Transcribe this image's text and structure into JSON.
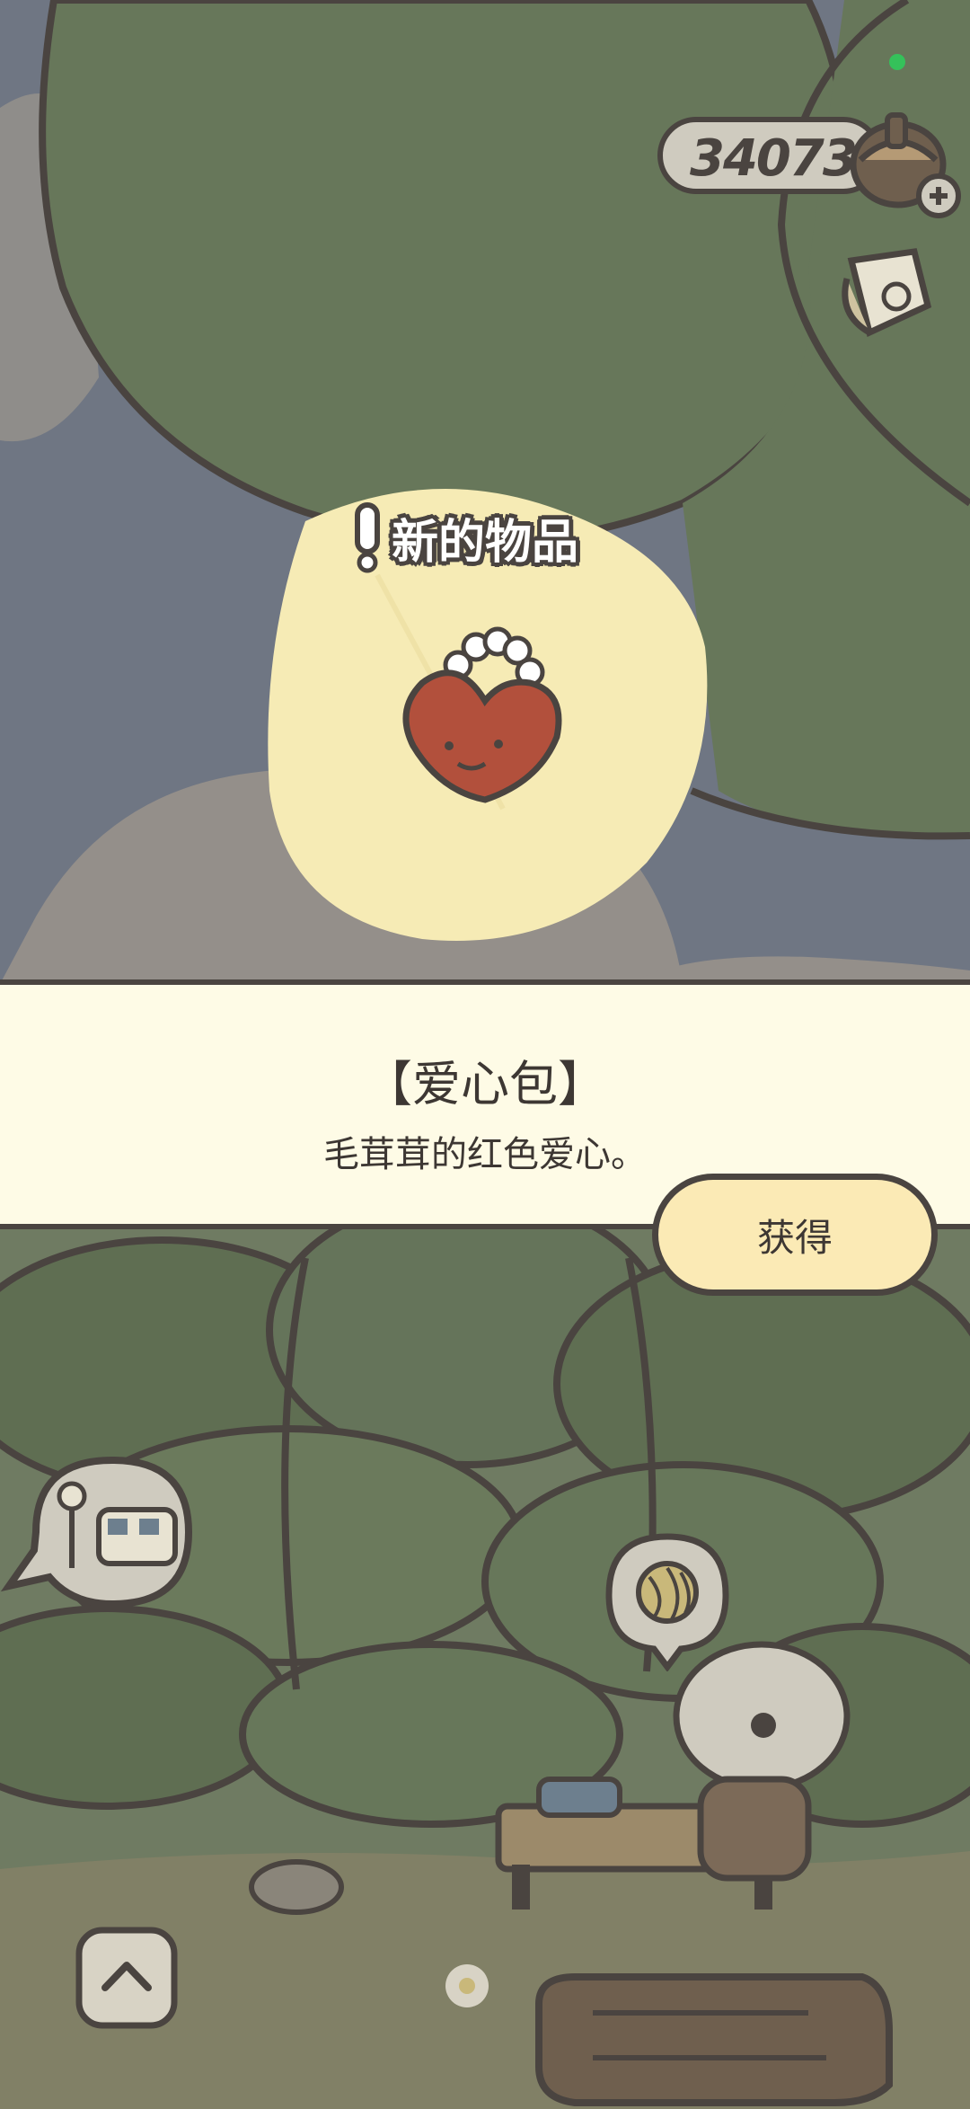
{
  "hud": {
    "acorn_count": "340731",
    "acorn_icon": "acorn-icon",
    "add_icon": "plus-icon",
    "notebook_icon": "notebook-icon"
  },
  "popup": {
    "badge_text": "新的物品",
    "badge_icon": "exclamation-icon",
    "item_icon": "heart-bag-icon",
    "item_name": "【爱心包】",
    "item_description": "毛茸茸的红色爱心。",
    "confirm_label": "获得"
  },
  "scene": {
    "train_bubble_icon": "train-station-icon",
    "yarn_bubble_icon": "yarn-ball-icon",
    "home_button_icon": "chevron-up-icon"
  },
  "colors": {
    "outline": "#4a4440",
    "panel": "#fefbe6",
    "button": "#fbeab5",
    "highlight": "#f6ebb5",
    "leaf_green": "#6b7a5c"
  }
}
